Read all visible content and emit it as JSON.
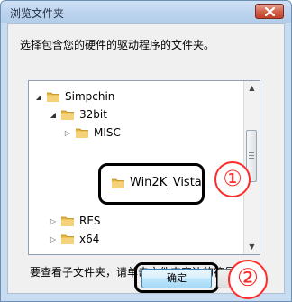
{
  "window": {
    "title": "浏览文件夹"
  },
  "instruction": "选择包含您的硬件的驱动程序的文件夹。",
  "tree": {
    "items": [
      {
        "label": "Simpchin",
        "level": 0,
        "state": "expanded"
      },
      {
        "label": "32bit",
        "level": 1,
        "state": "expanded"
      },
      {
        "label": "MISC",
        "level": 2,
        "state": "collapsed"
      },
      {
        "label": "Win2K_Vista",
        "level": 2,
        "state": "selected-highlighted"
      },
      {
        "label": "RES",
        "level": 1,
        "state": "collapsed"
      },
      {
        "label": "x64",
        "level": 1,
        "state": "collapsed"
      }
    ]
  },
  "hint": "要查看子文件夹，请单击文件夹旁边的符号。",
  "buttons": {
    "ok": "确定"
  },
  "callouts": {
    "one": "①",
    "two": "②"
  },
  "colors": {
    "callout_red": "#ff2a2a",
    "folder_yellow": "#e8b83a",
    "title_gradient": "#bcd3ee"
  }
}
